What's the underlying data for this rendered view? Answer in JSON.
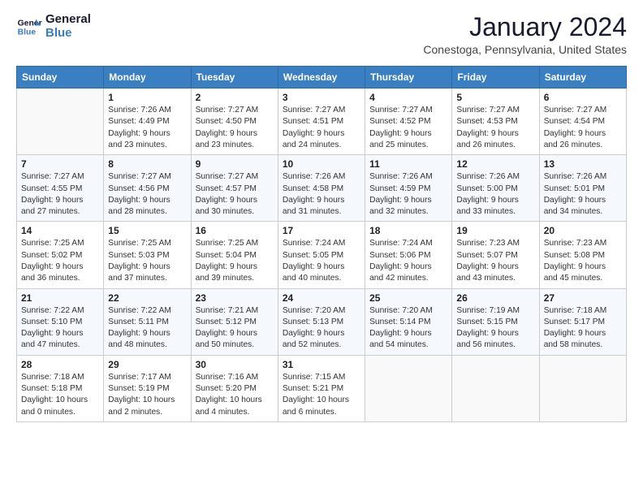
{
  "header": {
    "logo_line1": "General",
    "logo_line2": "Blue",
    "month": "January 2024",
    "location": "Conestoga, Pennsylvania, United States"
  },
  "weekdays": [
    "Sunday",
    "Monday",
    "Tuesday",
    "Wednesday",
    "Thursday",
    "Friday",
    "Saturday"
  ],
  "weeks": [
    [
      {
        "day": "",
        "info": ""
      },
      {
        "day": "1",
        "info": "Sunrise: 7:26 AM\nSunset: 4:49 PM\nDaylight: 9 hours\nand 23 minutes."
      },
      {
        "day": "2",
        "info": "Sunrise: 7:27 AM\nSunset: 4:50 PM\nDaylight: 9 hours\nand 23 minutes."
      },
      {
        "day": "3",
        "info": "Sunrise: 7:27 AM\nSunset: 4:51 PM\nDaylight: 9 hours\nand 24 minutes."
      },
      {
        "day": "4",
        "info": "Sunrise: 7:27 AM\nSunset: 4:52 PM\nDaylight: 9 hours\nand 25 minutes."
      },
      {
        "day": "5",
        "info": "Sunrise: 7:27 AM\nSunset: 4:53 PM\nDaylight: 9 hours\nand 26 minutes."
      },
      {
        "day": "6",
        "info": "Sunrise: 7:27 AM\nSunset: 4:54 PM\nDaylight: 9 hours\nand 26 minutes."
      }
    ],
    [
      {
        "day": "7",
        "info": "Sunrise: 7:27 AM\nSunset: 4:55 PM\nDaylight: 9 hours\nand 27 minutes."
      },
      {
        "day": "8",
        "info": "Sunrise: 7:27 AM\nSunset: 4:56 PM\nDaylight: 9 hours\nand 28 minutes."
      },
      {
        "day": "9",
        "info": "Sunrise: 7:27 AM\nSunset: 4:57 PM\nDaylight: 9 hours\nand 30 minutes."
      },
      {
        "day": "10",
        "info": "Sunrise: 7:26 AM\nSunset: 4:58 PM\nDaylight: 9 hours\nand 31 minutes."
      },
      {
        "day": "11",
        "info": "Sunrise: 7:26 AM\nSunset: 4:59 PM\nDaylight: 9 hours\nand 32 minutes."
      },
      {
        "day": "12",
        "info": "Sunrise: 7:26 AM\nSunset: 5:00 PM\nDaylight: 9 hours\nand 33 minutes."
      },
      {
        "day": "13",
        "info": "Sunrise: 7:26 AM\nSunset: 5:01 PM\nDaylight: 9 hours\nand 34 minutes."
      }
    ],
    [
      {
        "day": "14",
        "info": "Sunrise: 7:25 AM\nSunset: 5:02 PM\nDaylight: 9 hours\nand 36 minutes."
      },
      {
        "day": "15",
        "info": "Sunrise: 7:25 AM\nSunset: 5:03 PM\nDaylight: 9 hours\nand 37 minutes."
      },
      {
        "day": "16",
        "info": "Sunrise: 7:25 AM\nSunset: 5:04 PM\nDaylight: 9 hours\nand 39 minutes."
      },
      {
        "day": "17",
        "info": "Sunrise: 7:24 AM\nSunset: 5:05 PM\nDaylight: 9 hours\nand 40 minutes."
      },
      {
        "day": "18",
        "info": "Sunrise: 7:24 AM\nSunset: 5:06 PM\nDaylight: 9 hours\nand 42 minutes."
      },
      {
        "day": "19",
        "info": "Sunrise: 7:23 AM\nSunset: 5:07 PM\nDaylight: 9 hours\nand 43 minutes."
      },
      {
        "day": "20",
        "info": "Sunrise: 7:23 AM\nSunset: 5:08 PM\nDaylight: 9 hours\nand 45 minutes."
      }
    ],
    [
      {
        "day": "21",
        "info": "Sunrise: 7:22 AM\nSunset: 5:10 PM\nDaylight: 9 hours\nand 47 minutes."
      },
      {
        "day": "22",
        "info": "Sunrise: 7:22 AM\nSunset: 5:11 PM\nDaylight: 9 hours\nand 48 minutes."
      },
      {
        "day": "23",
        "info": "Sunrise: 7:21 AM\nSunset: 5:12 PM\nDaylight: 9 hours\nand 50 minutes."
      },
      {
        "day": "24",
        "info": "Sunrise: 7:20 AM\nSunset: 5:13 PM\nDaylight: 9 hours\nand 52 minutes."
      },
      {
        "day": "25",
        "info": "Sunrise: 7:20 AM\nSunset: 5:14 PM\nDaylight: 9 hours\nand 54 minutes."
      },
      {
        "day": "26",
        "info": "Sunrise: 7:19 AM\nSunset: 5:15 PM\nDaylight: 9 hours\nand 56 minutes."
      },
      {
        "day": "27",
        "info": "Sunrise: 7:18 AM\nSunset: 5:17 PM\nDaylight: 9 hours\nand 58 minutes."
      }
    ],
    [
      {
        "day": "28",
        "info": "Sunrise: 7:18 AM\nSunset: 5:18 PM\nDaylight: 10 hours\nand 0 minutes."
      },
      {
        "day": "29",
        "info": "Sunrise: 7:17 AM\nSunset: 5:19 PM\nDaylight: 10 hours\nand 2 minutes."
      },
      {
        "day": "30",
        "info": "Sunrise: 7:16 AM\nSunset: 5:20 PM\nDaylight: 10 hours\nand 4 minutes."
      },
      {
        "day": "31",
        "info": "Sunrise: 7:15 AM\nSunset: 5:21 PM\nDaylight: 10 hours\nand 6 minutes."
      },
      {
        "day": "",
        "info": ""
      },
      {
        "day": "",
        "info": ""
      },
      {
        "day": "",
        "info": ""
      }
    ]
  ]
}
